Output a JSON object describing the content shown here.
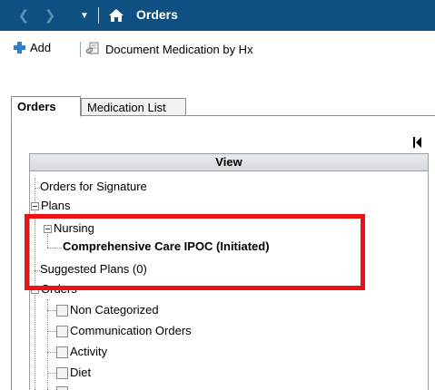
{
  "titlebar": {
    "title": "Orders",
    "back_icon": "back-icon",
    "forward_icon": "forward-icon",
    "dropdown_icon": "dropdown-icon",
    "home_icon": "home-icon",
    "background": "#0e5082"
  },
  "toolbar": {
    "add_label": "Add",
    "document_medication_label": "Document Medication by Hx"
  },
  "tabs": [
    {
      "label": "Orders",
      "active": true
    },
    {
      "label": "Medication List",
      "active": false
    }
  ],
  "view": {
    "header": "View",
    "items": [
      {
        "label": "Orders for Signature"
      },
      {
        "label": "Plans"
      },
      {
        "label": "Nursing"
      },
      {
        "label": "Comprehensive Care IPOC (Initiated)"
      },
      {
        "label": "Suggested Plans (0)"
      },
      {
        "label": "Orders"
      },
      {
        "label": "Non Categorized"
      },
      {
        "label": "Communication Orders"
      },
      {
        "label": "Activity"
      },
      {
        "label": "Diet"
      }
    ]
  },
  "highlight_color": "#ee1111"
}
